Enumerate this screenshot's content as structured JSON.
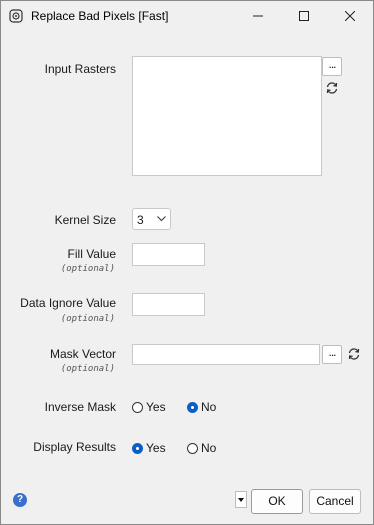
{
  "window": {
    "title": "Replace Bad Pixels [Fast]",
    "title_icon": "tool-dialog-icon",
    "controls": [
      "minimize-icon",
      "maximize-icon",
      "close-icon"
    ]
  },
  "form": {
    "input_rasters": {
      "label": "Input Rasters",
      "browse_label": "...",
      "refresh_icon": "refresh-icon"
    },
    "kernel_size": {
      "label": "Kernel Size",
      "value": "3"
    },
    "fill_value": {
      "label": "Fill Value",
      "optional": "(optional)",
      "value": ""
    },
    "data_ignore_value": {
      "label": "Data Ignore Value",
      "optional": "(optional)",
      "value": ""
    },
    "mask_vector": {
      "label": "Mask Vector",
      "optional": "(optional)",
      "value": "",
      "browse_label": "...",
      "refresh_icon": "refresh-icon"
    },
    "inverse_mask": {
      "label": "Inverse Mask",
      "options": [
        "Yes",
        "No"
      ],
      "selected": "No"
    },
    "display_results": {
      "label": "Display Results",
      "options": [
        "Yes",
        "No"
      ],
      "selected": "Yes"
    }
  },
  "footer": {
    "help_icon": "help-icon",
    "help_glyph": "?",
    "dropdown_icon": "caret-down-icon",
    "ok_label": "OK",
    "cancel_label": "Cancel"
  },
  "colors": {
    "accent": "#0a5fc4",
    "background": "#f0f0f0",
    "help": "#3a6fd0"
  }
}
